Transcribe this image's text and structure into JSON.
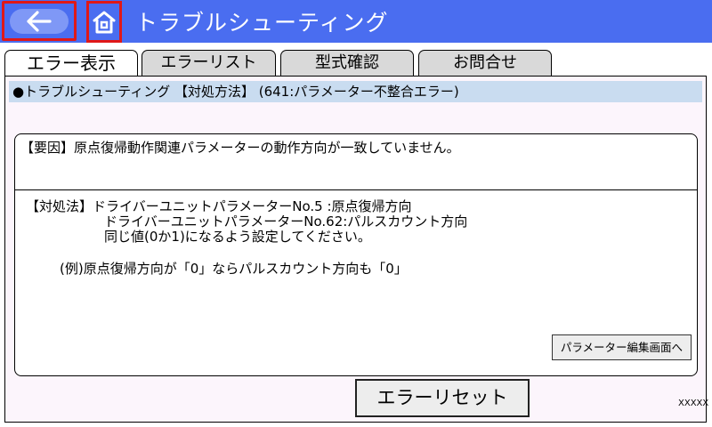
{
  "header": {
    "title": "トラブルシューティング",
    "bg_color": "#4a6df0",
    "back_icon": "arrow-left-icon",
    "home_icon": "home-icon"
  },
  "tabs": [
    {
      "label": "エラー表示",
      "active": true
    },
    {
      "label": "エラーリスト",
      "active": false
    },
    {
      "label": "型式確認",
      "active": false
    },
    {
      "label": "お問合せ",
      "active": false
    }
  ],
  "panel": {
    "heading": "●トラブルシューティング 【対処方法】 (641:パラメーター不整合エラー)",
    "cause": "【要因】原点復帰動作関連パラメーターの動作方向が一致していません。",
    "remedy_lines": [
      "【対処法】ドライバーユニットパラメーターNo.5 :原点復帰方向",
      "ドライバーユニットパラメーターNo.62:パルスカウント方向",
      "同じ値(0か1)になるよう設定してください。"
    ],
    "example": "(例)原点復帰方向が「0」ならパルスカウント方向も「0」",
    "param_button_label": "パラメーター編集画面へ"
  },
  "reset_button_label": "エラーリセット",
  "code_label": "XXXXX"
}
